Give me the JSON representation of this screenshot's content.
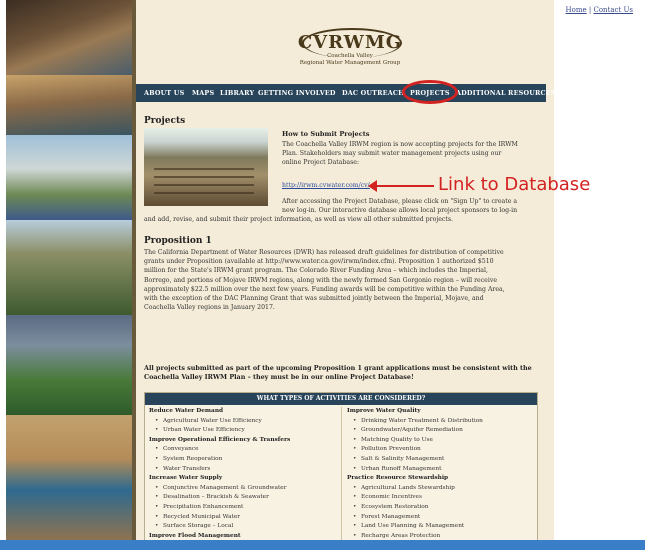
{
  "header": {
    "top_links": [
      "Home",
      "Contact Us"
    ],
    "top_links_separator": "|",
    "logo_mark": "CVRWMG",
    "logo_sub1": "Coachella Valley",
    "logo_sub2": "Regional Water Management Group"
  },
  "nav": {
    "items": [
      "ABOUT US",
      "MAPS",
      "LIBRARY",
      "GETTING INVOLVED",
      "DAC OUTREACH",
      "PROJECTS",
      "ADDITIONAL RESOURCES"
    ],
    "highlighted": "PROJECTS"
  },
  "projects": {
    "heading": "Projects",
    "how_heading": "How to Submit Projects",
    "how_line1": "The Coachella Valley IRWM region is now accepting projects for the IRWM",
    "how_line2": "Plan. Stakeholders may submit water management projects using our",
    "how_line3": "online Project Database:",
    "db_link": "http://irwm.cvwater.com/cv/",
    "after_line1": "After accessing the Project Database, please click on \"Sign Up\" to create a",
    "after_line2": "new log-in. Our interactive database allows local project sponsors to log-in",
    "after_line3": "and add, revise, and submit their project information, as well as view all other submitted projects."
  },
  "annotation": {
    "label": "Link to Database",
    "color": "#d32222"
  },
  "proposition": {
    "heading": "Proposition 1",
    "lines": [
      "The California Department of Water Resources (DWR) has released draft guidelines for distribution of competitive",
      "grants under Proposition (available at http://www.water.ca.gov/irwm/index.cfm). Proposition 1 authorized $510",
      "million for the State's IRWM grant program. The Colorado River Funding Area – which includes the Imperial,",
      "Borrego, and portions of Mojave IRWM regions, along with the newly formed San Gorgonio region – will receive",
      "approximately $22.5 million over the next few years. Funding awards will be competitive within the Funding Area,",
      "with the exception of the DAC Planning Grant that was submitted jointly between the Imperial, Mojave, and",
      "Coachella Valley regions in January 2017."
    ],
    "bold_notice": "All projects submitted as part of the upcoming Proposition 1 grant applications must be consistent with the Coachella Valley IRWM Plan – they must be in our online Project Database!"
  },
  "activities": {
    "title": "WHAT TYPES OF ACTIVITIES ARE CONSIDERED?",
    "left": [
      {
        "cat": "Reduce Water Demand",
        "items": [
          "Agricultural Water Use Efficiency",
          "Urban Water Use Efficiency"
        ]
      },
      {
        "cat": "Improve Operational Efficiency & Transfers",
        "items": [
          "Conveyance",
          "System Reoperation",
          "Water Transfers"
        ]
      },
      {
        "cat": "Increase Water Supply",
        "items": [
          "Conjunctive Management & Groundwater",
          "Desalination – Brackish & Seawater",
          "Precipitation Enhancement",
          "Recycled Municipal Water",
          "Surface Storage – Local"
        ]
      },
      {
        "cat": "Improve Flood Management",
        "items": []
      }
    ],
    "right": [
      {
        "cat": "Improve Water Quality",
        "items": [
          "Drinking Water Treatment & Distribution",
          "Groundwater/Aquifer Remediation",
          "Matching Quality to Use",
          "Pollution Prevention",
          "Salt & Salinity Management",
          "Urban Runoff Management"
        ]
      },
      {
        "cat": "Practice Resource Stewardship",
        "items": [
          "Agricultural Lands Stewardship",
          "Economic Incentives",
          "Ecosystem Restoration",
          "Forest Management",
          "Land Use Planning & Management",
          "Recharge Areas Protection"
        ]
      }
    ]
  },
  "colors": {
    "nav_bg": "#27445a",
    "page_bg": "#f4ecd8",
    "highlight": "#d32222",
    "footer_bar": "#3a7ec7"
  }
}
